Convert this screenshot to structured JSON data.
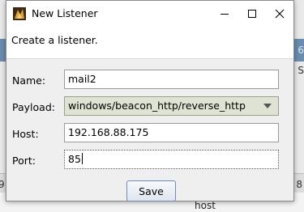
{
  "window": {
    "title": "New Listener",
    "header_text": "Create a listener."
  },
  "form": {
    "name_label": "Name:",
    "name_value": "mail2",
    "payload_label": "Payload:",
    "payload_value": "windows/beacon_http/reverse_http",
    "host_label": "Host:",
    "host_value": "192.168.88.175",
    "port_label": "Port:",
    "port_value": "85"
  },
  "buttons": {
    "save_label": "Save"
  },
  "background": {
    "host_fragment": "host",
    "left_fragment": "9",
    "right_fragment_a": "6",
    "right_fragment_b": "S",
    "right_fragment_c": "8"
  },
  "icons": {
    "app": "app-icon",
    "minimize": "minimize-icon",
    "maximize": "maximize-icon",
    "close": "close-icon",
    "dropdown": "chevron-down-icon"
  }
}
